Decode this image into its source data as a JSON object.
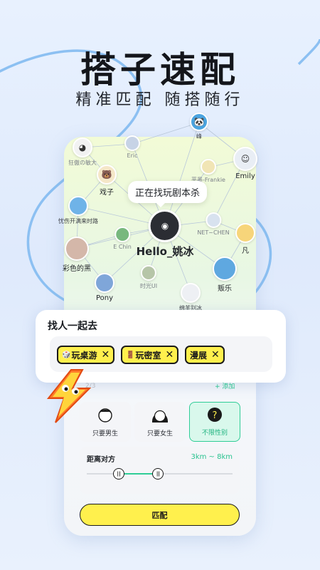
{
  "header": {
    "title": "搭子速配",
    "subtitle": "精准匹配 随搭随行"
  },
  "network": {
    "center": {
      "name": "Hello_姚冰",
      "bubble": "正在找玩剧本杀"
    },
    "users": [
      {
        "name": "峰",
        "color": "#4aa3df"
      },
      {
        "name": "Eric",
        "color": "#c7d3e6"
      },
      {
        "name": "狂傲の敏大",
        "color": "#f2f2f2"
      },
      {
        "name": "平墨-Frankie",
        "color": "#f1e5b5"
      },
      {
        "name": "Emily",
        "color": "#e9eef5"
      },
      {
        "name": "戏子",
        "color": "#f5e7c8"
      },
      {
        "name": "忧伤开满来时路",
        "color": "#6fb3e8"
      },
      {
        "name": "E Chin",
        "color": "#78b87e"
      },
      {
        "name": "NET~CHEN",
        "color": "#d8e2ef"
      },
      {
        "name": "凡",
        "color": "#f7d57a"
      },
      {
        "name": "彩色的黑",
        "color": "#d4b7a9"
      },
      {
        "name": "Pony",
        "color": "#7fa6d9"
      },
      {
        "name": "时光UI",
        "color": "#b6c5a8"
      },
      {
        "name": "贩乐",
        "color": "#5fa8e0"
      },
      {
        "name": "绵羊别冰",
        "color": "#eef0f4"
      }
    ]
  },
  "companion_card": {
    "title": "找人一起去",
    "tags": [
      {
        "icon": "🎲",
        "label": "玩桌游"
      },
      {
        "icon": "🚪",
        "label": "玩密室"
      },
      {
        "icon": "",
        "label": "漫展"
      }
    ]
  },
  "counter": "2/3",
  "add_label": "+ 添加",
  "gender_options": [
    {
      "label": "只要男生",
      "active": false
    },
    {
      "label": "只要女生",
      "active": false
    },
    {
      "label": "不限性别",
      "active": true
    }
  ],
  "distance": {
    "label": "距离对方",
    "value": "3km ~ 8km",
    "range_fraction": [
      0.22,
      0.49
    ]
  },
  "match_button": "匹配",
  "colors": {
    "accent_yellow": "#fff04d",
    "accent_green": "#2fcd96",
    "curve_blue": "#8cc0f2"
  }
}
